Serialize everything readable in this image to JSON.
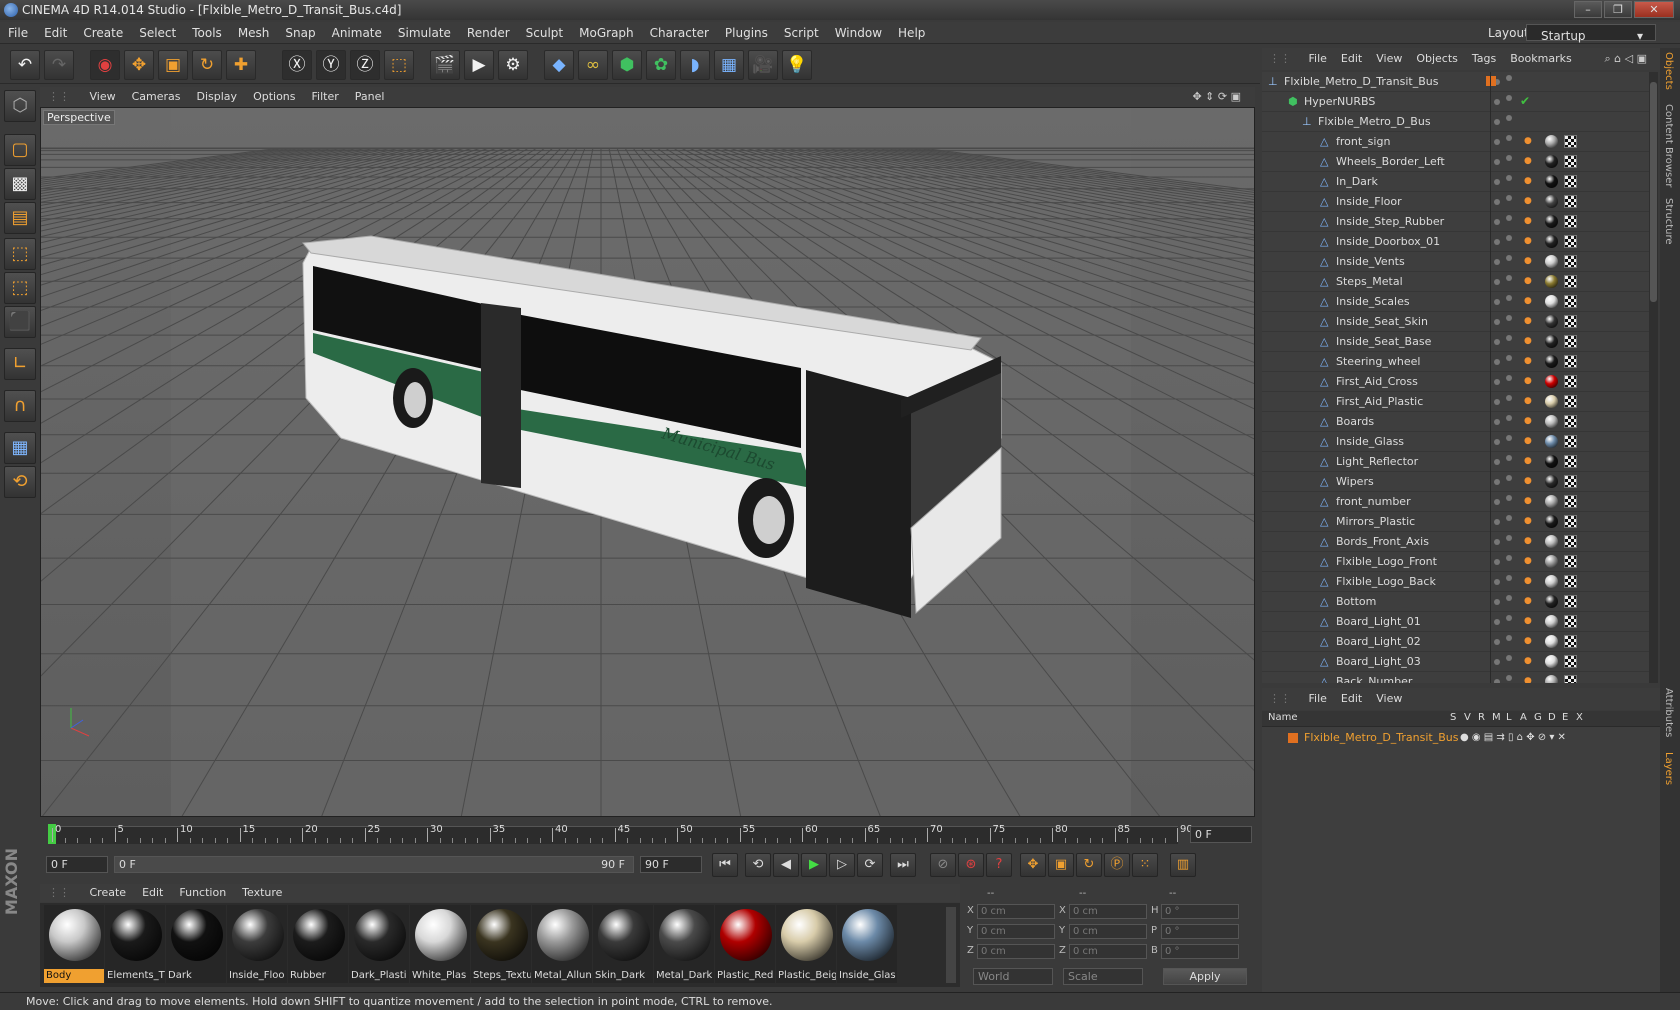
{
  "window": {
    "title": "CINEMA 4D R14.014 Studio - [Flxible_Metro_D_Transit_Bus.c4d]"
  },
  "menubar": {
    "items": [
      "File",
      "Edit",
      "Create",
      "Select",
      "Tools",
      "Mesh",
      "Snap",
      "Animate",
      "Simulate",
      "Render",
      "Sculpt",
      "MoGraph",
      "Character",
      "Plugins",
      "Script",
      "Window",
      "Help"
    ],
    "layout_label": "Layout:",
    "layout_value": "Startup"
  },
  "viewport": {
    "menu": [
      "View",
      "Cameras",
      "Display",
      "Options",
      "Filter",
      "Panel"
    ],
    "label": "Perspective",
    "bus_text": "Municipal Bus"
  },
  "timeline": {
    "ticks": [
      "0",
      "5",
      "10",
      "15",
      "20",
      "25",
      "30",
      "35",
      "40",
      "45",
      "50",
      "55",
      "60",
      "65",
      "70",
      "75",
      "80",
      "85",
      "90"
    ],
    "current_frame": "0 F"
  },
  "playbar": {
    "start": "0 F",
    "range_start": "0 F",
    "range_end": "90 F",
    "end": "90 F"
  },
  "materials": {
    "menu": [
      "Create",
      "Edit",
      "Function",
      "Texture"
    ],
    "items": [
      {
        "name": "Body",
        "color": "#c8c8c8"
      },
      {
        "name": "Elements_T",
        "color": "#1a1a1a"
      },
      {
        "name": "Dark",
        "color": "#111111"
      },
      {
        "name": "Inside_Floo",
        "color": "#3c3c3c"
      },
      {
        "name": "Rubber",
        "color": "#1c1c1c"
      },
      {
        "name": "Dark_Plasti",
        "color": "#2a2a2a"
      },
      {
        "name": "White_Plas",
        "color": "#d8d8d8"
      },
      {
        "name": "Steps_Textu",
        "color": "#3a3420"
      },
      {
        "name": "Metal_Allun",
        "color": "#9a9a9a"
      },
      {
        "name": "Skin_Dark",
        "color": "#3a3a3a"
      },
      {
        "name": "Metal_Dark",
        "color": "#4a4a4a"
      },
      {
        "name": "Plastic_Red",
        "color": "#b00000"
      },
      {
        "name": "Plastic_Beig",
        "color": "#d8ccaa"
      },
      {
        "name": "Inside_Glas",
        "color": "#6c8aa8"
      }
    ]
  },
  "coords": {
    "headers": [
      "--",
      "--",
      "--"
    ],
    "rows": [
      {
        "a": "X",
        "av": "0 cm",
        "b": "X",
        "bv": "0 cm",
        "c": "H",
        "cv": "0 °"
      },
      {
        "a": "Y",
        "av": "0 cm",
        "b": "Y",
        "bv": "0 cm",
        "c": "P",
        "cv": "0 °"
      },
      {
        "a": "Z",
        "av": "0 cm",
        "b": "Z",
        "bv": "0 cm",
        "c": "B",
        "cv": "0 °"
      }
    ],
    "mode1": "World",
    "mode2": "Scale",
    "apply": "Apply"
  },
  "status": "Move: Click and drag to move elements. Hold down SHIFT to quantize movement / add to the selection in point mode, CTRL to remove.",
  "objects": {
    "menu": [
      "File",
      "Edit",
      "View",
      "Objects",
      "Tags",
      "Bookmarks"
    ],
    "root": "Flxible_Metro_D_Transit_Bus",
    "nurbs": "HyperNURBS",
    "group": "Flxible_Metro_D_Bus",
    "children": [
      {
        "name": "front_sign",
        "color": "#aaaaaa"
      },
      {
        "name": "Wheels_Border_Left",
        "color": "#222222"
      },
      {
        "name": "In_Dark",
        "color": "#111111"
      },
      {
        "name": "Inside_Floor",
        "color": "#444444"
      },
      {
        "name": "Inside_Step_Rubber",
        "color": "#1a1a1a"
      },
      {
        "name": "Inside_Doorbox_01",
        "color": "#222222"
      },
      {
        "name": "Inside_Vents",
        "color": "#cccccc"
      },
      {
        "name": "Steps_Metal",
        "color": "#8a7a30"
      },
      {
        "name": "Inside_Scales",
        "color": "#dddddd"
      },
      {
        "name": "Inside_Seat_Skin",
        "color": "#333333"
      },
      {
        "name": "Inside_Seat_Base",
        "color": "#222222"
      },
      {
        "name": "Steering_wheel",
        "color": "#1a1a1a"
      },
      {
        "name": "First_Aid_Cross",
        "color": "#cc0000"
      },
      {
        "name": "First_Aid_Plastic",
        "color": "#d8ccaa"
      },
      {
        "name": "Boards",
        "color": "#bbbbbb"
      },
      {
        "name": "Inside_Glass",
        "color": "#6c8aa8"
      },
      {
        "name": "Light_Reflector",
        "color": "#111111"
      },
      {
        "name": "Wipers",
        "color": "#2a2a2a"
      },
      {
        "name": "front_number",
        "color": "#aaaaaa"
      },
      {
        "name": "Mirrors_Plastic",
        "color": "#1a1a1a"
      },
      {
        "name": "Bords_Front_Axis",
        "color": "#bbbbbb"
      },
      {
        "name": "Flxible_Logo_Front",
        "color": "#999999"
      },
      {
        "name": "Flxible_Logo_Back",
        "color": "#cccccc"
      },
      {
        "name": "Bottom",
        "color": "#222222"
      },
      {
        "name": "Board_Light_01",
        "color": "#cccccc"
      },
      {
        "name": "Board_Light_02",
        "color": "#dddddd"
      },
      {
        "name": "Board_Light_03",
        "color": "#dddddd"
      },
      {
        "name": "Back_Number",
        "color": "#aaaaaa"
      }
    ]
  },
  "layers": {
    "menu": [
      "File",
      "Edit",
      "View"
    ],
    "columns": [
      "Name",
      "S",
      "V",
      "R",
      "M",
      "L",
      "A",
      "G",
      "D",
      "E",
      "X"
    ],
    "item": "Flxible_Metro_D_Transit_Bus"
  },
  "righttabs": [
    "Objects",
    "Content Browser",
    "Structure"
  ],
  "righttabs2": [
    "Attributes",
    "Layers"
  ]
}
